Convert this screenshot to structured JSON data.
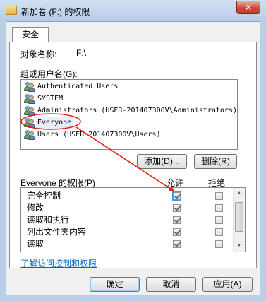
{
  "window": {
    "title": "新加卷 (F:) 的权限",
    "close_label": "✕"
  },
  "tab": {
    "label": "安全"
  },
  "object": {
    "label": "对象名称:",
    "value": "F:\\"
  },
  "groups": {
    "label": "组或用户名(G):",
    "users": [
      {
        "name": "Authenticated Users"
      },
      {
        "name": "SYSTEM"
      },
      {
        "name": "Administrators (USER-201407300V\\Administrators)"
      },
      {
        "name": "Everyone"
      },
      {
        "name": "Users (USER-201407300V\\Users)"
      }
    ]
  },
  "buttons": {
    "add": "添加(D)...",
    "remove": "删除(R)",
    "ok": "确定",
    "cancel": "取消",
    "apply": "应用(A)"
  },
  "permissions": {
    "label": "Everyone 的权限(P)",
    "allow_header": "允许",
    "deny_header": "拒绝",
    "rows": [
      {
        "name": "完全控制",
        "allow": true,
        "deny": false
      },
      {
        "name": "修改",
        "allow": true,
        "deny": false
      },
      {
        "name": "读取和执行",
        "allow": true,
        "deny": false
      },
      {
        "name": "列出文件夹内容",
        "allow": true,
        "deny": false
      },
      {
        "name": "读取",
        "allow": true,
        "deny": false
      }
    ]
  },
  "link": {
    "label": "了解访问控制和权限"
  },
  "annotation": {
    "color": "#e8201e"
  }
}
